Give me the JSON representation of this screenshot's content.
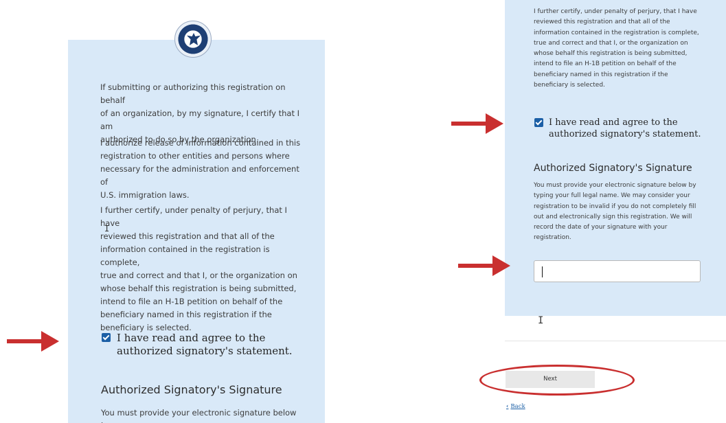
{
  "left": {
    "paragraphs": [
      "If submitting or authorizing this registration on behalf\nof an organization, by my signature, I certify that I am\nauthorized to do so by the organization.",
      "I authorize release of information contained in this\nregistration to other entities and persons where\nnecessary for the administration and enforcement of\nU.S. immigration laws.",
      "I further certify, under penalty of perjury, that I have\nreviewed this registration and that all of the\ninformation contained in the registration is complete,\ntrue and correct and that I, or the organization on\nwhose behalf this registration is being submitted,\nintend to file an H-1B petition on behalf of the\nbeneficiary named in this registration if the\nbeneficiary is selected."
    ],
    "agree_label": "I have read and agree to the\nauthorized signatory's statement.",
    "agree_checked": true,
    "heading": "Authorized Signatory's Signature",
    "signature_intro": "You must provide your electronic signature below by"
  },
  "right": {
    "paragraph": "I further certify, under penalty of perjury, that I have\nreviewed this registration and that all of the\ninformation contained in the registration is complete,\ntrue and correct and that I, or the organization on\nwhose behalf this registration is being submitted,\nintend to file an H-1B petition on behalf of the\nbeneficiary named in this registration if the\nbeneficiary is selected.",
    "agree_label": "I have read and agree to the\nauthorized signatory's statement.",
    "agree_checked": true,
    "heading": "Authorized Signatory's Signature",
    "signature_instructions": "You must provide your electronic signature below by\ntyping your full legal name. We may consider your\nregistration to be invalid if you do not completely fill\nout and electronically sign this registration. We will\nrecord the date of your signature with your\nregistration.",
    "signature_value": "",
    "next_label": "Next",
    "back_label": "Back"
  },
  "icons": {
    "seal": "dhs-seal-icon",
    "arrow": "red-arrow-icon",
    "back_chevron": "chevron-left-icon"
  },
  "colors": {
    "panel": "#d9e9f8",
    "checkbox": "#1b5fa6",
    "annotation": "#c92f2f",
    "link": "#1b5fa6"
  }
}
